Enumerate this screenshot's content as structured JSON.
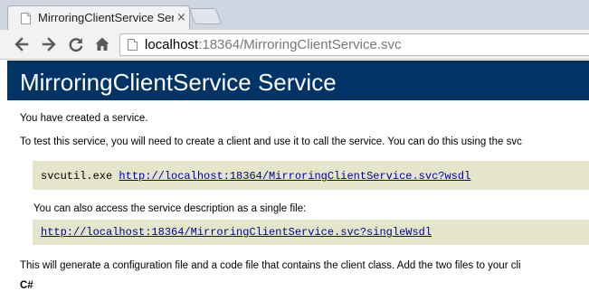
{
  "browser": {
    "tab_title": "MirroringClientService Service",
    "tab_close": "×",
    "url_host": "localhost",
    "url_rest": ":18364/MirroringClientService.svc"
  },
  "page": {
    "heading": "MirroringClientService Service",
    "intro": "You have created a service.",
    "test_text": "To test this service, you will need to create a client and use it to call the service. You can do this using the svc",
    "svcutil_cmd": "svcutil.exe",
    "wsdl_link": "http://localhost:18364/MirroringClientService.svc?wsdl",
    "single_file_text": "You can also access the service description as a single file:",
    "single_wsdl_link": "http://localhost:18364/MirroringClientService.svc?singleWsdl",
    "generate_text": "This will generate a configuration file and a code file that contains the client class. Add the two files to your cli",
    "csharp_label": "C#"
  }
}
